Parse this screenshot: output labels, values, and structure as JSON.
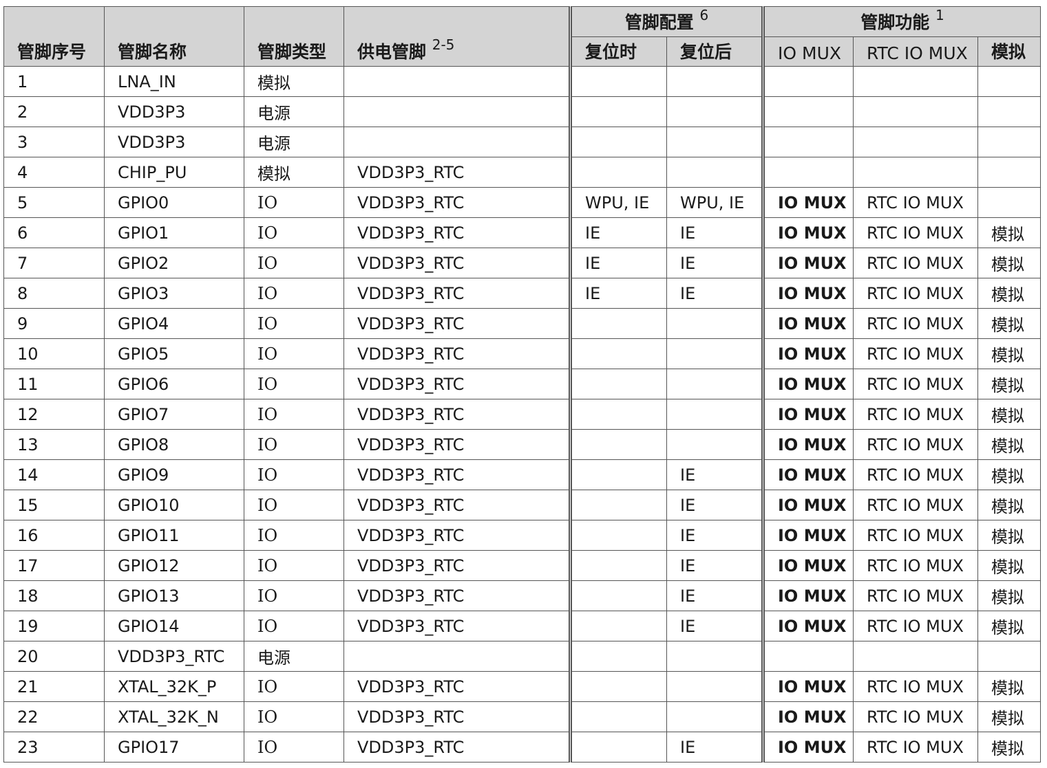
{
  "headers": {
    "pin_no": "管脚序号",
    "pin_name": "管脚名称",
    "pin_type": "管脚类型",
    "power": "供电管脚",
    "power_sup": "2-5",
    "config_group": "管脚配置",
    "config_sup": "6",
    "reset": "复位时",
    "after_reset": "复位后",
    "func_group": "管脚功能",
    "func_sup": "1",
    "io_mux": "IO MUX",
    "rtc_io_mux": "RTC IO MUX",
    "analog": "模拟"
  },
  "rows": [
    {
      "no": "1",
      "name": "LNA_IN",
      "type": "模拟",
      "power": "",
      "reset": "",
      "after": "",
      "iomux": "",
      "rtc": "",
      "analog": ""
    },
    {
      "no": "2",
      "name": "VDD3P3",
      "type": "电源",
      "power": "",
      "reset": "",
      "after": "",
      "iomux": "",
      "rtc": "",
      "analog": ""
    },
    {
      "no": "3",
      "name": "VDD3P3",
      "type": "电源",
      "power": "",
      "reset": "",
      "after": "",
      "iomux": "",
      "rtc": "",
      "analog": ""
    },
    {
      "no": "4",
      "name": "CHIP_PU",
      "type": "模拟",
      "power": "VDD3P3_RTC",
      "reset": "",
      "after": "",
      "iomux": "",
      "rtc": "",
      "analog": ""
    },
    {
      "no": "5",
      "name": "GPIO0",
      "type": "IO",
      "power": "VDD3P3_RTC",
      "reset": "WPU, IE",
      "after": "WPU, IE",
      "iomux": "IO MUX",
      "rtc": "RTC IO MUX",
      "analog": ""
    },
    {
      "no": "6",
      "name": "GPIO1",
      "type": "IO",
      "power": "VDD3P3_RTC",
      "reset": "IE",
      "after": "IE",
      "iomux": "IO MUX",
      "rtc": "RTC IO MUX",
      "analog": "模拟"
    },
    {
      "no": "7",
      "name": "GPIO2",
      "type": "IO",
      "power": "VDD3P3_RTC",
      "reset": "IE",
      "after": "IE",
      "iomux": "IO MUX",
      "rtc": "RTC IO MUX",
      "analog": "模拟"
    },
    {
      "no": "8",
      "name": "GPIO3",
      "type": "IO",
      "power": "VDD3P3_RTC",
      "reset": "IE",
      "after": "IE",
      "iomux": "IO MUX",
      "rtc": "RTC IO MUX",
      "analog": "模拟"
    },
    {
      "no": "9",
      "name": "GPIO4",
      "type": "IO",
      "power": "VDD3P3_RTC",
      "reset": "",
      "after": "",
      "iomux": "IO MUX",
      "rtc": "RTC IO MUX",
      "analog": "模拟"
    },
    {
      "no": "10",
      "name": "GPIO5",
      "type": "IO",
      "power": "VDD3P3_RTC",
      "reset": "",
      "after": "",
      "iomux": "IO MUX",
      "rtc": "RTC IO MUX",
      "analog": "模拟"
    },
    {
      "no": "11",
      "name": "GPIO6",
      "type": "IO",
      "power": "VDD3P3_RTC",
      "reset": "",
      "after": "",
      "iomux": "IO MUX",
      "rtc": "RTC IO MUX",
      "analog": "模拟"
    },
    {
      "no": "12",
      "name": "GPIO7",
      "type": "IO",
      "power": "VDD3P3_RTC",
      "reset": "",
      "after": "",
      "iomux": "IO MUX",
      "rtc": "RTC IO MUX",
      "analog": "模拟"
    },
    {
      "no": "13",
      "name": "GPIO8",
      "type": "IO",
      "power": "VDD3P3_RTC",
      "reset": "",
      "after": "",
      "iomux": "IO MUX",
      "rtc": "RTC IO MUX",
      "analog": "模拟"
    },
    {
      "no": "14",
      "name": "GPIO9",
      "type": "IO",
      "power": "VDD3P3_RTC",
      "reset": "",
      "after": "IE",
      "iomux": "IO MUX",
      "rtc": "RTC IO MUX",
      "analog": "模拟"
    },
    {
      "no": "15",
      "name": "GPIO10",
      "type": "IO",
      "power": "VDD3P3_RTC",
      "reset": "",
      "after": "IE",
      "iomux": "IO MUX",
      "rtc": "RTC IO MUX",
      "analog": "模拟"
    },
    {
      "no": "16",
      "name": "GPIO11",
      "type": "IO",
      "power": "VDD3P3_RTC",
      "reset": "",
      "after": "IE",
      "iomux": "IO MUX",
      "rtc": "RTC IO MUX",
      "analog": "模拟"
    },
    {
      "no": "17",
      "name": "GPIO12",
      "type": "IO",
      "power": "VDD3P3_RTC",
      "reset": "",
      "after": "IE",
      "iomux": "IO MUX",
      "rtc": "RTC IO MUX",
      "analog": "模拟"
    },
    {
      "no": "18",
      "name": "GPIO13",
      "type": "IO",
      "power": "VDD3P3_RTC",
      "reset": "",
      "after": "IE",
      "iomux": "IO MUX",
      "rtc": "RTC IO MUX",
      "analog": "模拟"
    },
    {
      "no": "19",
      "name": "GPIO14",
      "type": "IO",
      "power": "VDD3P3_RTC",
      "reset": "",
      "after": "IE",
      "iomux": "IO MUX",
      "rtc": "RTC IO MUX",
      "analog": "模拟"
    },
    {
      "no": "20",
      "name": "VDD3P3_RTC",
      "type": "电源",
      "power": "",
      "reset": "",
      "after": "",
      "iomux": "",
      "rtc": "",
      "analog": ""
    },
    {
      "no": "21",
      "name": "XTAL_32K_P",
      "type": "IO",
      "power": "VDD3P3_RTC",
      "reset": "",
      "after": "",
      "iomux": "IO MUX",
      "rtc": "RTC IO MUX",
      "analog": "模拟"
    },
    {
      "no": "22",
      "name": "XTAL_32K_N",
      "type": "IO",
      "power": "VDD3P3_RTC",
      "reset": "",
      "after": "",
      "iomux": "IO MUX",
      "rtc": "RTC IO MUX",
      "analog": "模拟"
    },
    {
      "no": "23",
      "name": "GPIO17",
      "type": "IO",
      "power": "VDD3P3_RTC",
      "reset": "",
      "after": "IE",
      "iomux": "IO MUX",
      "rtc": "RTC IO MUX",
      "analog": "模拟"
    }
  ]
}
